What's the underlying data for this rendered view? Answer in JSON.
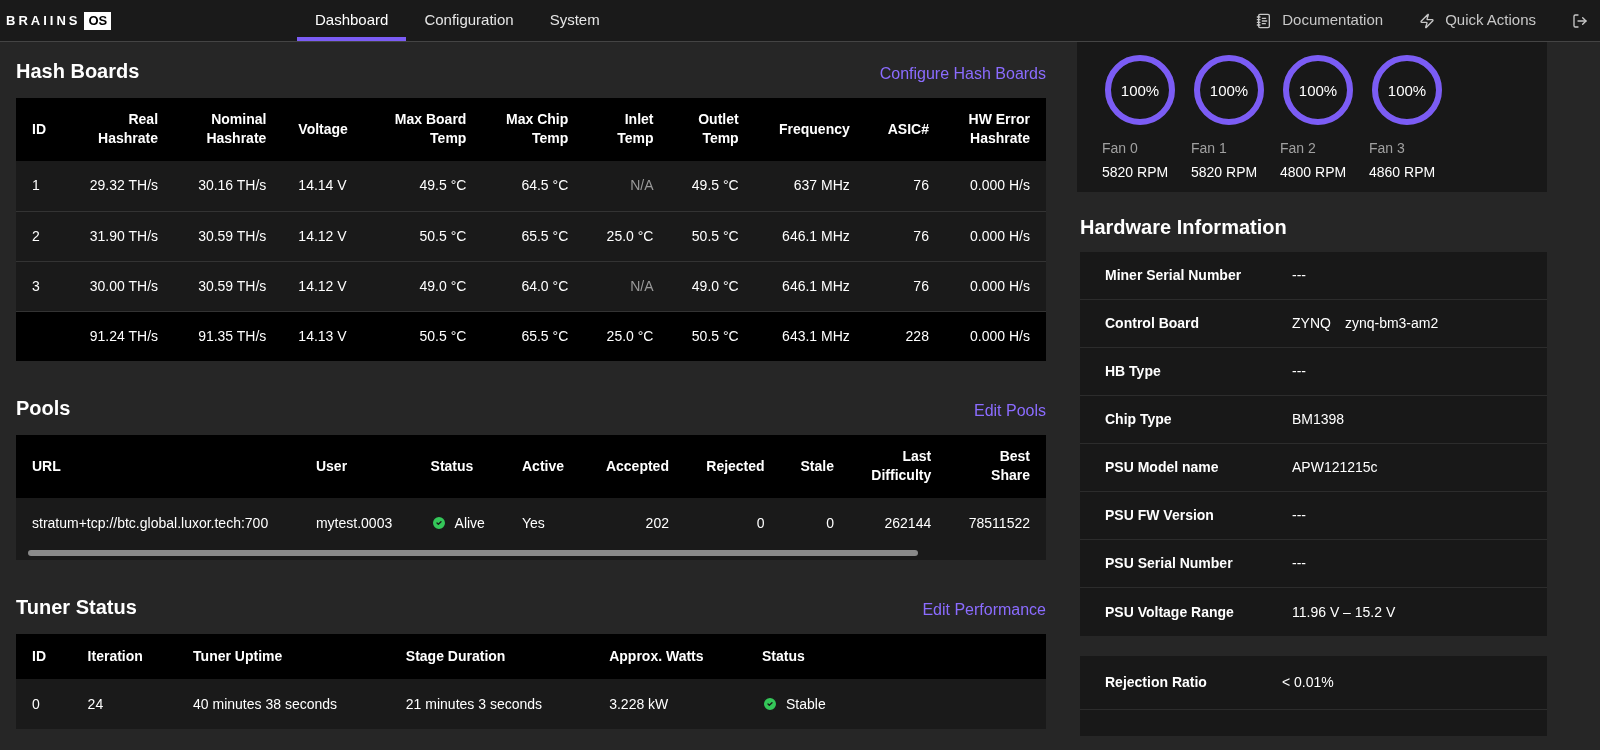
{
  "logo": {
    "word": "BRAIINS",
    "badge": "OS"
  },
  "nav": {
    "tabs": [
      {
        "label": "Dashboard",
        "selected": true
      },
      {
        "label": "Configuration",
        "selected": false
      },
      {
        "label": "System",
        "selected": false
      }
    ],
    "actions": [
      "Documentation",
      "Quick Actions"
    ]
  },
  "hash_boards": {
    "title": "Hash Boards",
    "link": "Configure Hash Boards",
    "columns": [
      "ID",
      "Real\nHashrate",
      "Nominal\nHashrate",
      "Voltage",
      "Max Board\nTemp",
      "Max Chip\nTemp",
      "Inlet\nTemp",
      "Outlet\nTemp",
      "Frequency",
      "ASIC#",
      "HW Error\nHashrate"
    ],
    "rows": [
      [
        "1",
        "29.32 TH/s",
        "30.16 TH/s",
        "14.14 V",
        "49.5 °C",
        "64.5 °C",
        "N/A",
        "49.5 °C",
        "637 MHz",
        "76",
        "0.000 H/s"
      ],
      [
        "2",
        "31.90 TH/s",
        "30.59 TH/s",
        "14.12 V",
        "50.5 °C",
        "65.5 °C",
        "25.0 °C",
        "50.5 °C",
        "646.1 MHz",
        "76",
        "0.000 H/s"
      ],
      [
        "3",
        "30.00 TH/s",
        "30.59 TH/s",
        "14.12 V",
        "49.0 °C",
        "64.0 °C",
        "N/A",
        "49.0 °C",
        "646.1 MHz",
        "76",
        "0.000 H/s"
      ],
      [
        "",
        "91.24 TH/s",
        "91.35 TH/s",
        "14.13 V",
        "50.5 °C",
        "65.5 °C",
        "25.0 °C",
        "50.5 °C",
        "643.1 MHz",
        "228",
        "0.000 H/s"
      ]
    ]
  },
  "pools": {
    "title": "Pools",
    "link": "Edit Pools",
    "columns": [
      "URL",
      "User",
      "Status",
      "Active",
      "Accepted",
      "Rejected",
      "Stale",
      "Last\nDifficulty",
      "Best\nShare"
    ],
    "rows": [
      {
        "url": "stratum+tcp://btc.global.luxor.tech:700",
        "user": "mytest.0003",
        "status": "Alive",
        "ok": true,
        "active": "Yes",
        "accepted": "202",
        "rejected": "0",
        "stale": "0",
        "last_difficulty": "262144",
        "best_share": "78511522"
      }
    ]
  },
  "tuner": {
    "title": "Tuner Status",
    "link": "Edit Performance",
    "columns": [
      "ID",
      "Iteration",
      "Tuner Uptime",
      "Stage Duration",
      "Approx. Watts",
      "Status"
    ],
    "rows": [
      {
        "id": "0",
        "iteration": "24",
        "uptime": "40 minutes 38 seconds",
        "stage": "21 minutes 3 seconds",
        "watts": "3.228 kW",
        "status": "Stable",
        "ok": true
      }
    ]
  },
  "fans": [
    {
      "reading": "100%",
      "level": 1,
      "name": "Fan 0",
      "rpm": "5820 RPM"
    },
    {
      "reading": "100%",
      "level": 1,
      "name": "Fan 1",
      "rpm": "5820 RPM"
    },
    {
      "reading": "100%",
      "level": 1,
      "name": "Fan 2",
      "rpm": "4800 RPM"
    },
    {
      "reading": "100%",
      "level": 1,
      "name": "Fan 3",
      "rpm": "4860 RPM"
    }
  ],
  "hardware": {
    "title": "Hardware Information",
    "rows": [
      {
        "label": "Miner Serial Number",
        "values": [
          "---"
        ]
      },
      {
        "label": "Control Board",
        "values": [
          "ZYNQ",
          "zynq-bm3-am2"
        ]
      },
      {
        "label": "HB Type",
        "values": [
          "---"
        ]
      },
      {
        "label": "Chip Type",
        "values": [
          "BM1398"
        ]
      },
      {
        "label": "PSU Model name",
        "values": [
          "APW121215c"
        ]
      },
      {
        "label": "PSU FW Version",
        "values": [
          "---"
        ]
      },
      {
        "label": "PSU Serial Number",
        "values": [
          "---"
        ]
      },
      {
        "label": "PSU Voltage Range",
        "values": [
          "11.96 V – 15.2 V"
        ]
      }
    ]
  },
  "stats": [
    {
      "label": "Rejection Ratio",
      "value": "< 0.01%"
    }
  ]
}
